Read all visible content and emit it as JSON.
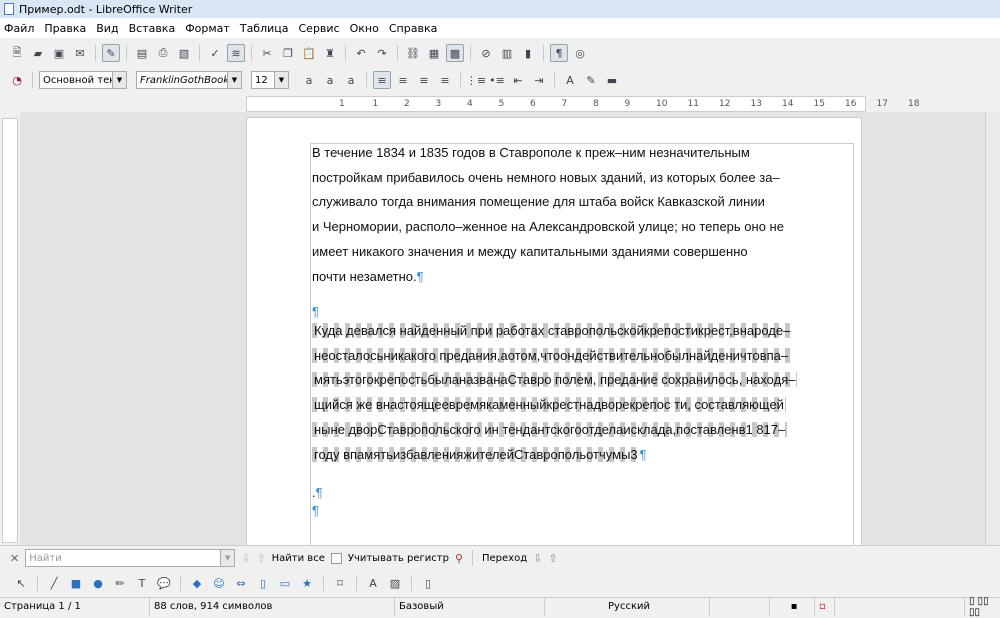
{
  "window": {
    "title": "Пример.odt - LibreOffice Writer"
  },
  "menu": [
    "Файл",
    "Правка",
    "Вид",
    "Вставка",
    "Формат",
    "Таблица",
    "Сервис",
    "Окно",
    "Справка"
  ],
  "standard_toolbar": [
    "new-document-icon",
    "open-folder-icon",
    "save-icon",
    "email-icon",
    "edit-mode-icon",
    "export-pdf-icon",
    "print-icon",
    "print-preview-icon",
    "spellcheck-icon",
    "auto-spellcheck-icon",
    "cut-icon",
    "copy-icon",
    "paste-icon",
    "clone-formatting-icon",
    "undo-icon",
    "redo-icon",
    "hyperlink-icon",
    "table-icon",
    "show-draw-functions-icon",
    "navigator-icon",
    "gallery-icon",
    "data-sources-icon",
    "formatting-marks-icon",
    "help-icon"
  ],
  "formatting_toolbar": {
    "paragraph_style": "Основной текс",
    "font_name": "FranklinGothBookTT",
    "font_size": "12",
    "buttons": [
      "bold-icon",
      "italic-icon",
      "underline-icon",
      "align-left-icon",
      "align-center-icon",
      "align-right-icon",
      "justify-icon",
      "numbering-icon",
      "bullets-icon",
      "decrease-indent-icon",
      "increase-indent-icon",
      "font-color-icon",
      "highlight-icon",
      "background-color-icon"
    ]
  },
  "ruler": {
    "labels": [
      "1",
      "1",
      "2",
      "3",
      "4",
      "5",
      "6",
      "7",
      "8",
      "9",
      "10",
      "11",
      "12",
      "13",
      "14",
      "15",
      "16",
      "17",
      "18"
    ]
  },
  "document": {
    "para1": [
      "В течение 1834 и 1835 годов в Ставрополе к преж–ним  незначительным",
      "постройкам  прибавилось очень немного новых зданий, из которых более за–",
      "служивало  тогда  внимания  помещение  для  штаба войск  Кавказской  линии",
      "и  Черномории,   располо–женное на Александровской улице; но теперь оно не",
      "имеет  никакого  значения  и  между  капитальными зданиями совершенно",
      "почти незаметно."
    ],
    "para2": [
      "Куда девался найденный при работах ставропольскойкрепостикрест,внароде–",
      "неосталосьникакого предания,аотом,чтоондействительнобылнайденичтовпа–",
      "мятьэтогокрепостьбыланазванаСтавро полем, предание сохранилось, находя–",
      "щийся же внастоящеевремякаменныйкрестнадворекрепос ти, составляющей",
      "ныне дворСтавропольского ин тендантскогоотделаисклада,поставленв1 817–",
      "году впамятьизбавленияжителейСтавропольотчумы3"
    ],
    "dot_line": ".",
    "pilcrow": "¶"
  },
  "findbar": {
    "placeholder": "Найти",
    "find_all": "Найти все",
    "match_case": "Учитывать регистр",
    "goto": "Переход"
  },
  "drawing_toolbar": [
    "select-icon",
    "line-icon",
    "rectangle-icon",
    "ellipse-icon",
    "freeform-icon",
    "text-icon",
    "callout-icon",
    "basic-shapes-icon",
    "symbol-shapes-icon",
    "block-arrows-icon",
    "flowchart-icon",
    "callouts-icon",
    "stars-icon",
    "points-icon",
    "fontwork-icon",
    "image-icon",
    "extrusion-icon"
  ],
  "status": {
    "page": "Страница 1 / 1",
    "words": "88 слов, 914 символов",
    "style": "Базовый",
    "language": "Русский"
  }
}
